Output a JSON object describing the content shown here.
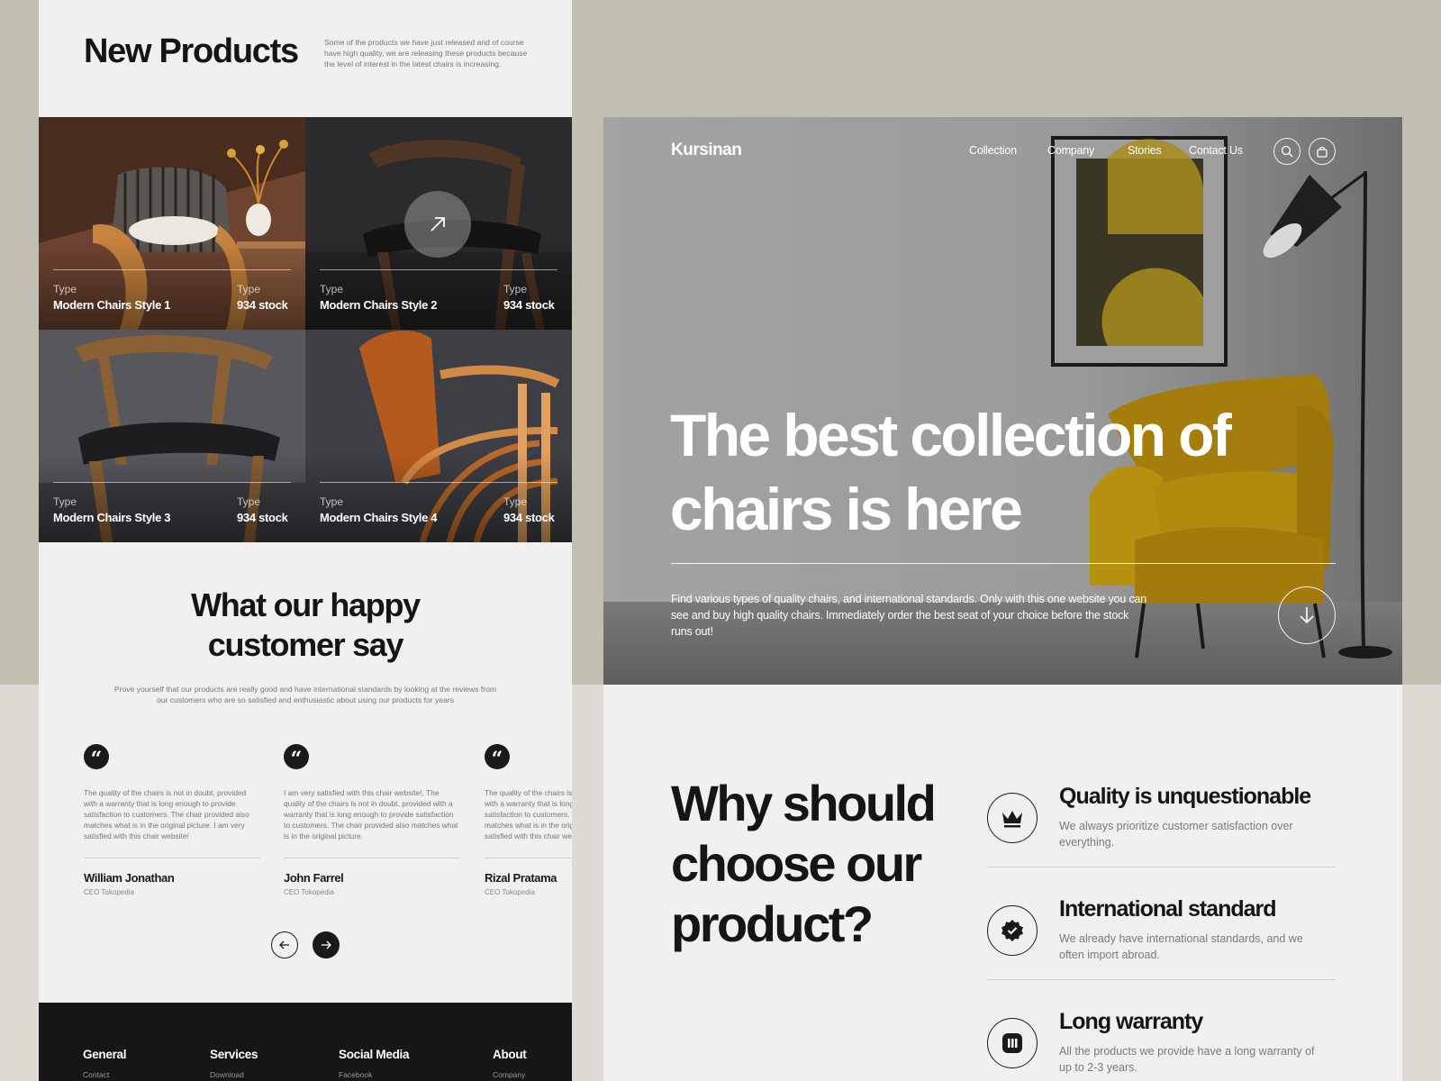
{
  "new_products": {
    "title": "New Products",
    "description": "Some of the products we have just released and of course have high quality, we are releasing these products because the level of interest in the latest chairs is increasing.",
    "items": [
      {
        "type_label": "Type",
        "name": "Modern Chairs Style 1",
        "stock_label": "Type",
        "stock": "934 stock"
      },
      {
        "type_label": "Type",
        "name": "Modern Chairs Style 2",
        "stock_label": "Type",
        "stock": "934 stock"
      },
      {
        "type_label": "Type",
        "name": "Modern Chairs Style 3",
        "stock_label": "Type",
        "stock": "934 stock"
      },
      {
        "type_label": "Type",
        "name": "Modern Chairs Style 4",
        "stock_label": "Type",
        "stock": "934 stock"
      }
    ]
  },
  "testimonials": {
    "title_line1": "What our happy",
    "title_line2": "customer say",
    "description": "Prove yourself that our products are really good and have international standards by looking at the reviews from our customers who are so satisfied and enthusiastic about using our products for years",
    "reviews": [
      {
        "text": "The quality of the chairs is not in doubt, provided with a warranty that is long enough to provide satisfaction to customers. The chair provided also matches what is in the original picture. I am very satisfied with this chair website!",
        "name": "William Jonathan",
        "role": "CEO Tokopedia"
      },
      {
        "text": "I am very satisfied with this chair website!, The quality of the chairs is not in doubt, provided with a warranty that is long enough to provide satisfaction to customers. The chair provided also matches what is in the original picture.",
        "name": "John Farrel",
        "role": "CEO Tokopedia"
      },
      {
        "text": "The quality of the chairs is not in doubt, provided with a warranty that is long enough to provide satisfaction to customers. The chair provided also matches what is in the original picture. I am very satisfied with this chair website!",
        "name": "Rizal Pratama",
        "role": "CEO Tokopedia"
      }
    ],
    "prev_icon": "arrow-left-icon",
    "next_icon": "arrow-right-icon"
  },
  "footer": {
    "columns": [
      {
        "heading": "General",
        "first_item": "Contact"
      },
      {
        "heading": "Services",
        "first_item": "Download"
      },
      {
        "heading": "Social Media",
        "first_item": "Facebook"
      },
      {
        "heading": "About",
        "first_item": "Company"
      }
    ]
  },
  "hero": {
    "logo": "Kursinan",
    "nav": [
      "Collection",
      "Company",
      "Stories",
      "Contact Us"
    ],
    "icons": [
      "search-icon",
      "shopping-bag-icon"
    ],
    "title_line1": "The best collection of",
    "title_line2": "chairs is here",
    "description": "Find various types of quality chairs, and international standards. Only with this one website you can see and buy high quality chairs. Immediately order the best seat of your choice before the stock runs out!",
    "scroll_icon": "arrow-down-icon"
  },
  "why": {
    "title": "Why should choose our product?",
    "features": [
      {
        "title": "Quality is unquestionable",
        "description": "We always prioritize customer satisfaction over everything.",
        "icon": "crown-icon"
      },
      {
        "title": "International standard",
        "description": "We already have international standards, and we often import abroad.",
        "icon": "verified-badge-icon"
      },
      {
        "title": "Long warranty",
        "description": "All the products we provide have a long warranty of up to 2-3 years.",
        "icon": "warranty-icon"
      }
    ]
  },
  "colors": {
    "background_top": "#c1bfb2",
    "background_bottom": "#dedbd4",
    "panel": "#f1f0ee",
    "dark": "#161616",
    "chair_mustard": "#b8900f"
  }
}
